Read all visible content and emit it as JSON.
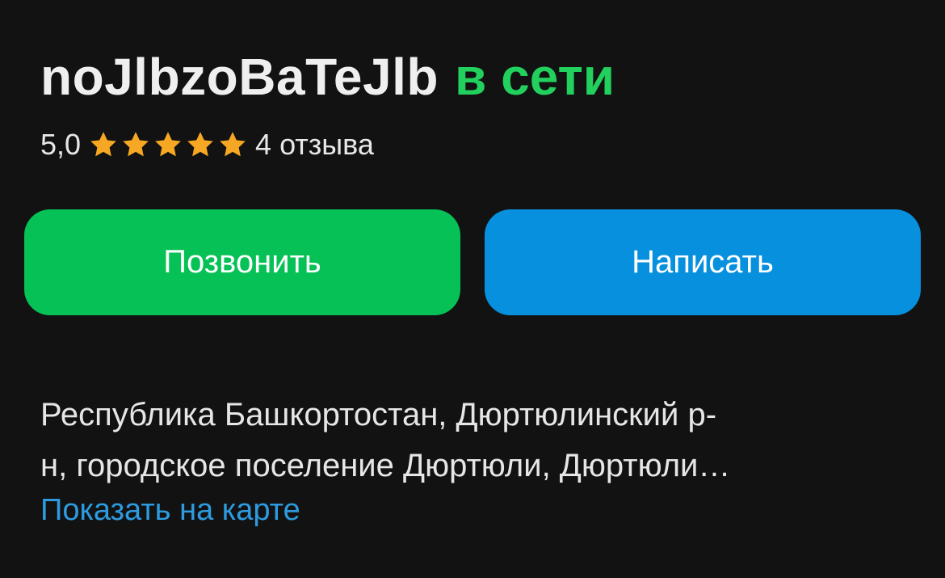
{
  "profile": {
    "username": "noJlbzoBaTeJlb",
    "status": "в сети",
    "status_color": "#22d05d"
  },
  "rating": {
    "score": "5,0",
    "stars": 5,
    "reviews_label": "4 отзыва",
    "star_color": "#f6a723"
  },
  "actions": {
    "call_label": "Позвонить",
    "call_color": "#06c155",
    "write_label": "Написать",
    "write_color": "#0790dd"
  },
  "address": {
    "line1": "Республика Башкортостан, Дюртюлинский р-",
    "line2": "н, городское поселение Дюртюли, Дюртюли…",
    "map_link_label": "Показать на карте"
  }
}
